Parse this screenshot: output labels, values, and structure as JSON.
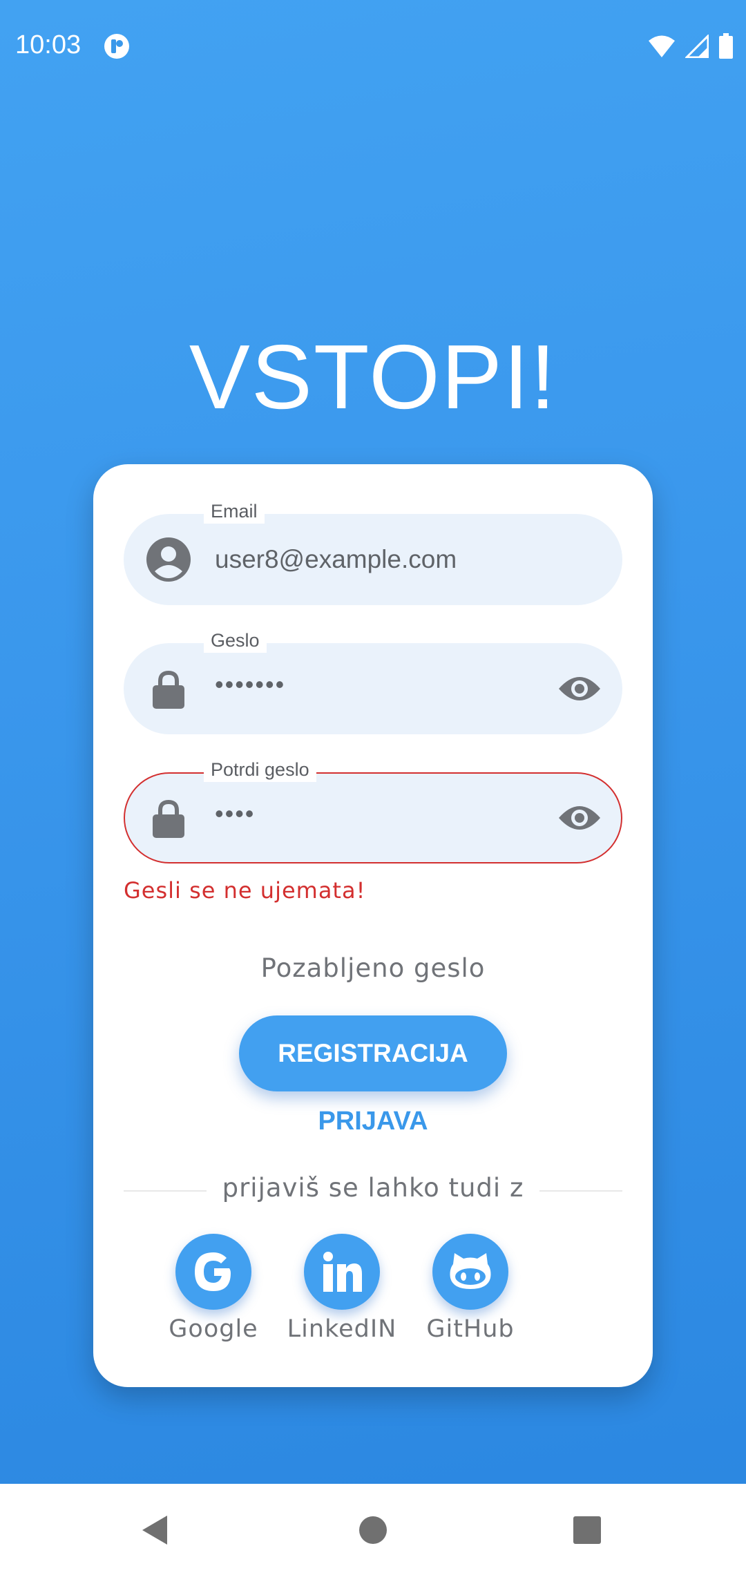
{
  "status_bar": {
    "time": "10:03",
    "icons": [
      "app-notification-icon",
      "wifi-icon",
      "signal-icon",
      "battery-icon"
    ]
  },
  "title": "VSTOPI!",
  "form": {
    "email": {
      "label": "Email",
      "value": "user8@example.com",
      "icon": "account-icon"
    },
    "password": {
      "label": "Geslo",
      "value": "•••••••",
      "icon": "lock-icon",
      "trailing_icon": "eye-icon"
    },
    "confirm_password": {
      "label": "Potrdi geslo",
      "value": "••••",
      "icon": "lock-icon",
      "trailing_icon": "eye-icon",
      "error": "Gesli se ne ujemata!"
    }
  },
  "forgot_password": "Pozabljeno geslo",
  "register_button": "REGISTRACIJA",
  "login_link": "PRIJAVA",
  "divider_text": "prijaviš se lahko tudi z",
  "social": [
    {
      "label": "Google",
      "icon": "google-icon"
    },
    {
      "label": "LinkedIN",
      "icon": "linkedin-icon"
    },
    {
      "label": "GitHub",
      "icon": "github-icon"
    }
  ],
  "colors": {
    "accent": "#42a0f0",
    "error": "#d32f2f",
    "field_bg": "#eaf2fb"
  },
  "nav_bar": [
    "back-icon",
    "home-icon",
    "recents-icon"
  ]
}
